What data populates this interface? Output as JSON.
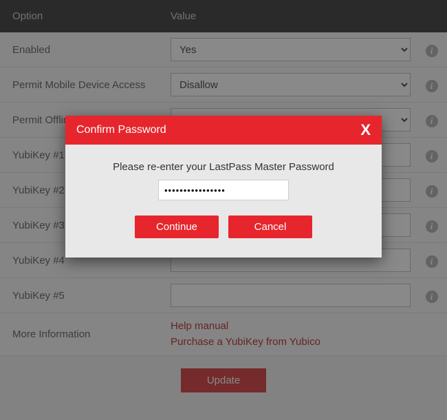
{
  "header": {
    "option": "Option",
    "value": "Value"
  },
  "rows": {
    "enabled": {
      "label": "Enabled",
      "value": "Yes"
    },
    "mobile": {
      "label": "Permit Mobile Device Access",
      "value": "Disallow"
    },
    "offline": {
      "label": "Permit Offline Access",
      "value": ""
    },
    "yk1": {
      "label": "YubiKey #1",
      "value": ""
    },
    "yk2": {
      "label": "YubiKey #2",
      "value": ""
    },
    "yk3": {
      "label": "YubiKey #3",
      "value": ""
    },
    "yk4": {
      "label": "YubiKey #4",
      "value": ""
    },
    "yk5": {
      "label": "YubiKey #5",
      "value": ""
    },
    "more": {
      "label": "More Information",
      "link1": "Help manual",
      "link2": "Purchase a YubiKey from Yubico"
    }
  },
  "footer": {
    "update": "Update"
  },
  "modal": {
    "title": "Confirm Password",
    "close": "X",
    "prompt": "Please re-enter your LastPass Master Password",
    "password_value": "••••••••••••••••",
    "continue": "Continue",
    "cancel": "Cancel"
  }
}
